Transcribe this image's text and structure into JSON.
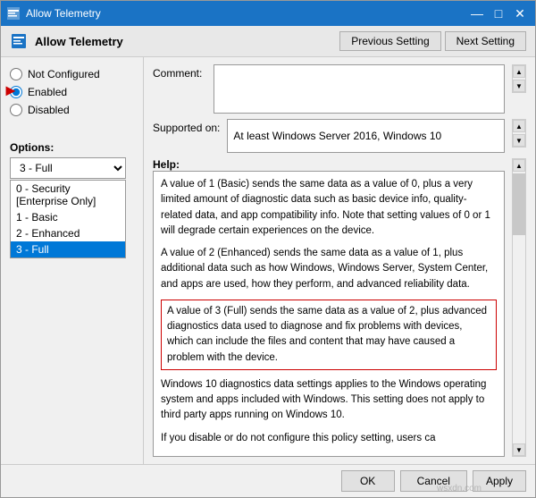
{
  "window": {
    "title": "Allow Telemetry",
    "icon": "settings-policy-icon"
  },
  "header": {
    "title": "Allow Telemetry",
    "prev_button": "Previous Setting",
    "next_button": "Next Setting"
  },
  "left_panel": {
    "radio_options": [
      {
        "id": "not-configured",
        "label": "Not Configured",
        "checked": false
      },
      {
        "id": "enabled",
        "label": "Enabled",
        "checked": true
      },
      {
        "id": "disabled",
        "label": "Disabled",
        "checked": false
      }
    ],
    "options_label": "Options:",
    "dropdown_value": "3 - Full",
    "dropdown_items": [
      {
        "label": "0 - Security [Enterprise Only]",
        "selected": false
      },
      {
        "label": "1 - Basic",
        "selected": false
      },
      {
        "label": "2 - Enhanced",
        "selected": false
      },
      {
        "label": "3 - Full",
        "selected": true
      }
    ]
  },
  "comment": {
    "label": "Comment:",
    "value": ""
  },
  "supported": {
    "label": "Supported on:",
    "value": "At least Windows Server 2016, Windows 10"
  },
  "help": {
    "label": "Help:",
    "paragraphs": [
      {
        "text": "A value of 1 (Basic) sends the same data as a value of 0, plus a very limited amount of diagnostic data such as basic device info, quality-related data, and app compatibility info. Note that setting values of 0 or 1 will degrade certain experiences on the device.",
        "highlighted": false
      },
      {
        "text": "A value of 2 (Enhanced) sends the same data as a value of 1, plus additional data such as how Windows, Windows Server, System Center, and apps are used, how they perform, and advanced reliability data.",
        "highlighted": false
      },
      {
        "text": "A value of 3 (Full) sends the same data as a value of 2, plus advanced diagnostics data used to diagnose and fix problems with devices, which can include the files and content that may have caused a problem with the device.",
        "highlighted": true
      },
      {
        "text": "Windows 10 diagnostics data settings applies to the Windows operating system and apps included with Windows. This setting does not apply to third party apps running on Windows 10.",
        "highlighted": false
      },
      {
        "text": "If you disable or do not configure this policy setting, users ca",
        "highlighted": false
      }
    ]
  },
  "footer": {
    "ok_label": "OK",
    "cancel_label": "Cancel",
    "apply_label": "Apply"
  },
  "watermark": "wsxdn.com"
}
